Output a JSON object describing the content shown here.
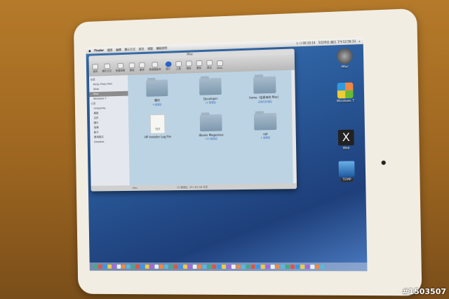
{
  "menubar": {
    "apple": "",
    "app": "Finder",
    "items": [
      "檔案",
      "編輯",
      "顯示方式",
      "前往",
      "視窗",
      "輔助說明"
    ],
    "battery": "(-:-) 00:10:14",
    "clock": "5月29日 週日 下午12:56:33"
  },
  "window": {
    "title": "iMac",
    "toolbar": [
      {
        "label": "返回",
        "icon": "back-forward-icon"
      },
      {
        "label": "顯示方式",
        "icon": "view-icon"
      },
      {
        "label": "快速查看",
        "icon": "eye-icon"
      },
      {
        "label": "路徑",
        "icon": "path-icon"
      },
      {
        "label": "動作",
        "icon": "gear-icon"
      },
      {
        "label": "新增檔案夾",
        "icon": "new-folder-icon"
      },
      {
        "label": "簡介",
        "icon": "info-icon"
      },
      {
        "label": "工具",
        "icon": "tools-icon"
      },
      {
        "label": "燒錄",
        "icon": "burn-icon"
      },
      {
        "label": "刪除",
        "icon": "delete-icon"
      },
      {
        "label": "退出",
        "icon": "eject-icon"
      },
      {
        "label": "iDisk",
        "icon": "idisk-icon"
      }
    ],
    "sidebar": {
      "devices_header": "裝置",
      "devices": [
        "Ricky Pinky Mini",
        "iDisk",
        "iMac",
        "Windows 7"
      ],
      "selected": "iMac",
      "places_header": "位置",
      "places": [
        "rickypinky",
        "桌面",
        "文件",
        "圖片",
        "音樂",
        "影片",
        "應用程式",
        "Dropbox"
      ]
    },
    "items": [
      {
        "name": "備份",
        "sub": "4 個項目",
        "type": "folder"
      },
      {
        "name": "Developer",
        "sub": "12 個項目",
        "type": "folder"
      },
      {
        "name": "home（從原來的 Mac）",
        "sub": "沒有任何項目",
        "type": "folder"
      },
      {
        "name": "HP Installer Log File",
        "sub": "",
        "type": "txt",
        "badge": "TXT"
      },
      {
        "name": "iBooks Magazines",
        "sub": "239 個項目",
        "type": "folder"
      },
      {
        "name": "opt",
        "sub": "1 個項目",
        "type": "folder"
      }
    ],
    "path": "iMac",
    "status": "15 個項目，617.84 GB 可用"
  },
  "desktop": [
    {
      "label": "iMac",
      "icon": "mac-disk-icon"
    },
    {
      "label": "Windows 7",
      "icon": "windows-icon"
    },
    {
      "label": "Web",
      "icon": "x-web-icon"
    },
    {
      "label": "TEMP",
      "icon": "folder-icon"
    }
  ],
  "watermark": "#1503507"
}
